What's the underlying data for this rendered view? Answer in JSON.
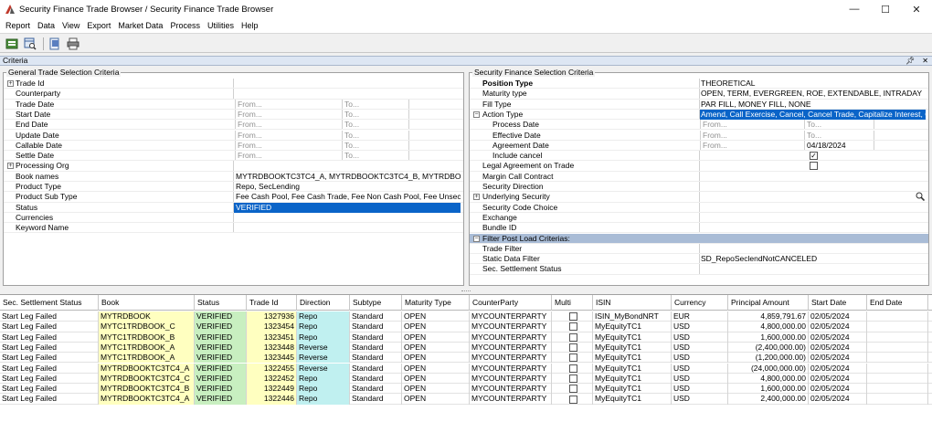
{
  "window": {
    "title": "Security Finance Trade Browser / Security Finance Trade Browser",
    "minimize": "—",
    "maximize": "☐",
    "close": "✕"
  },
  "menu": [
    "Report",
    "Data",
    "View",
    "Export",
    "Market Data",
    "Process",
    "Utilities",
    "Help"
  ],
  "criteria_header": "Criteria",
  "left_panel": {
    "title": "General Trade Selection Criteria",
    "rows": [
      {
        "name": "Trade Id",
        "expander": "+",
        "value": "",
        "from": "",
        "to": ""
      },
      {
        "name": "Counterparty",
        "expander": "",
        "value": "",
        "from": "",
        "to": ""
      },
      {
        "name": "Trade Date",
        "expander": "",
        "value": "",
        "from": "From...",
        "to": "To..."
      },
      {
        "name": "Start Date",
        "expander": "",
        "value": "",
        "from": "From...",
        "to": "To..."
      },
      {
        "name": "End Date",
        "expander": "",
        "value": "",
        "from": "From...",
        "to": "To..."
      },
      {
        "name": "Update Date",
        "expander": "",
        "value": "",
        "from": "From...",
        "to": "To..."
      },
      {
        "name": "Callable Date",
        "expander": "",
        "value": "",
        "from": "From...",
        "to": "To..."
      },
      {
        "name": "Settle Date",
        "expander": "",
        "value": "",
        "from": "From...",
        "to": "To..."
      },
      {
        "name": "Processing Org",
        "expander": "+",
        "value": "",
        "from": "",
        "to": ""
      },
      {
        "name": "Book names",
        "expander": "",
        "value": "MYTRDBOOKTC3TC4_A, MYTRDBOOKTC3TC4_B, MYTRDBOOKTC3T...",
        "from": "",
        "to": ""
      },
      {
        "name": "Product Type",
        "expander": "",
        "value": "Repo, SecLending",
        "from": "",
        "to": ""
      },
      {
        "name": "Product Sub Type",
        "expander": "",
        "value": "Fee Cash Pool, Fee Cash Trade, Fee Non Cash Pool, Fee Unsecured...",
        "from": "",
        "to": ""
      },
      {
        "name": "Status",
        "expander": "",
        "value": "VERIFIED",
        "from": "",
        "to": "",
        "selected": true
      },
      {
        "name": "Currencies",
        "expander": "",
        "value": "",
        "from": "",
        "to": ""
      },
      {
        "name": "Keyword Name",
        "expander": "",
        "value": "",
        "from": "",
        "to": ""
      }
    ]
  },
  "right_panel": {
    "title": "Security Finance Selection Criteria",
    "rows": [
      {
        "name": "Position Type",
        "indent": 0,
        "bold": true,
        "expander": "",
        "value": "THEORETICAL"
      },
      {
        "name": "Maturity type",
        "indent": 0,
        "expander": "",
        "value": "OPEN, TERM, EVERGREEN, ROE, EXTENDABLE, INTRADAY"
      },
      {
        "name": "Fill Type",
        "indent": 0,
        "expander": "",
        "value": "PAR FILL, MONEY FILL, NONE"
      },
      {
        "name": "Action Type",
        "indent": 0,
        "expander": "−",
        "value": "Amend, Call Exercise, Cancel, Cancel Trade, Capitalize Interest, Clo...",
        "selected": true
      },
      {
        "name": "Process Date",
        "indent": 1,
        "expander": "",
        "from": "From...",
        "to": "To..."
      },
      {
        "name": "Effective Date",
        "indent": 1,
        "expander": "",
        "from": "From...",
        "to": "To..."
      },
      {
        "name": "Agreement Date",
        "indent": 1,
        "expander": "",
        "from": "From...",
        "to": "04/18/2024",
        "to_dark": true
      },
      {
        "name": "Include cancel",
        "indent": 1,
        "expander": "",
        "checkbox": true,
        "checked": true
      },
      {
        "name": "Legal Agreement on Trade",
        "indent": 0,
        "expander": "",
        "checkbox": true,
        "checked": false
      },
      {
        "name": "Margin Call Contract",
        "indent": 0,
        "expander": "",
        "value": ""
      },
      {
        "name": "Security Direction",
        "indent": 0,
        "expander": "",
        "value": ""
      },
      {
        "name": "Underlying Security",
        "indent": 0,
        "expander": "+",
        "value": "",
        "search": true
      },
      {
        "name": "Security Code Choice",
        "indent": 0,
        "expander": "",
        "value": ""
      },
      {
        "name": "Exchange",
        "indent": 0,
        "expander": "",
        "value": ""
      },
      {
        "name": "Bundle ID",
        "indent": 0,
        "expander": "",
        "value": ""
      },
      {
        "name": "Filter Post Load Criterias:",
        "indent": 0,
        "expander": "−",
        "value": "",
        "section": true
      },
      {
        "name": "Trade Filter",
        "indent": 0,
        "expander": "",
        "value": ""
      },
      {
        "name": "Static Data Filter",
        "indent": 0,
        "expander": "",
        "value": "SD_RepoSeclendNotCANCELED"
      },
      {
        "name": "Sec. Settlement Status",
        "indent": 0,
        "expander": "",
        "value": ""
      }
    ]
  },
  "grid": {
    "columns": [
      "Sec. Settlement Status",
      "Book",
      "Status",
      "Trade Id",
      "Direction",
      "Subtype",
      "Maturity Type",
      "CounterParty",
      "Multi",
      "ISIN",
      "Currency",
      "Principal Amount",
      "Start Date",
      "End Date"
    ],
    "rows": [
      [
        "Start Leg Failed",
        "MYTRDBOOK",
        "VERIFIED",
        "1327936",
        "Repo",
        "Standard",
        "OPEN",
        "MYCOUNTERPARTY",
        "",
        "ISIN_MyBondNRT",
        "EUR",
        "4,859,791.67",
        "02/05/2024",
        ""
      ],
      [
        "Start Leg Failed",
        "MYTC1TRDBOOK_C",
        "VERIFIED",
        "1323454",
        "Repo",
        "Standard",
        "OPEN",
        "MYCOUNTERPARTY",
        "",
        "MyEquityTC1",
        "USD",
        "4,800,000.00",
        "02/05/2024",
        ""
      ],
      [
        "Start Leg Failed",
        "MYTC1TRDBOOK_B",
        "VERIFIED",
        "1323451",
        "Repo",
        "Standard",
        "OPEN",
        "MYCOUNTERPARTY",
        "",
        "MyEquityTC1",
        "USD",
        "1,600,000.00",
        "02/05/2024",
        ""
      ],
      [
        "Start Leg Failed",
        "MYTC1TRDBOOK_A",
        "VERIFIED",
        "1323448",
        "Reverse",
        "Standard",
        "OPEN",
        "MYCOUNTERPARTY",
        "",
        "MyEquityTC1",
        "USD",
        "(2,400,000.00)",
        "02/05/2024",
        ""
      ],
      [
        "Start Leg Failed",
        "MYTC1TRDBOOK_A",
        "VERIFIED",
        "1323445",
        "Reverse",
        "Standard",
        "OPEN",
        "MYCOUNTERPARTY",
        "",
        "MyEquityTC1",
        "USD",
        "(1,200,000.00)",
        "02/05/2024",
        ""
      ],
      [
        "Start Leg Failed",
        "MYTRDBOOKTC3TC4_A",
        "VERIFIED",
        "1322455",
        "Reverse",
        "Standard",
        "OPEN",
        "MYCOUNTERPARTY",
        "",
        "MyEquityTC1",
        "USD",
        "(24,000,000.00)",
        "02/05/2024",
        ""
      ],
      [
        "Start Leg Failed",
        "MYTRDBOOKTC3TC4_C",
        "VERIFIED",
        "1322452",
        "Repo",
        "Standard",
        "OPEN",
        "MYCOUNTERPARTY",
        "",
        "MyEquityTC1",
        "USD",
        "4,800,000.00",
        "02/05/2024",
        ""
      ],
      [
        "Start Leg Failed",
        "MYTRDBOOKTC3TC4_B",
        "VERIFIED",
        "1322449",
        "Repo",
        "Standard",
        "OPEN",
        "MYCOUNTERPARTY",
        "",
        "MyEquityTC1",
        "USD",
        "1,600,000.00",
        "02/05/2024",
        ""
      ],
      [
        "Start Leg Failed",
        "MYTRDBOOKTC3TC4_A",
        "VERIFIED",
        "1322446",
        "Repo",
        "Standard",
        "OPEN",
        "MYCOUNTERPARTY",
        "",
        "MyEquityTC1",
        "USD",
        "2,400,000.00",
        "02/05/2024",
        ""
      ]
    ]
  },
  "colors": {
    "book": "#ffffc0",
    "status": "#c8efc0",
    "trade_id": "#ffffc0",
    "direction": "#c0f0f0",
    "selection": "#0a64c8"
  }
}
